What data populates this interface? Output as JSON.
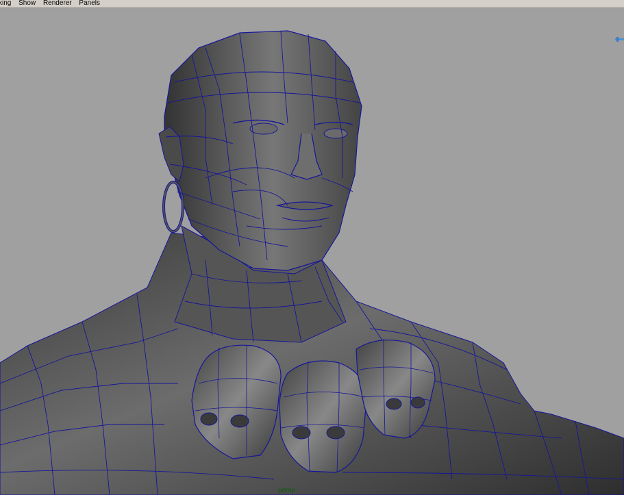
{
  "menubar": {
    "items": [
      {
        "label": "king"
      },
      {
        "label": "Show"
      },
      {
        "label": "Renderer"
      },
      {
        "label": "Panels"
      }
    ]
  },
  "viewport": {
    "camera_label": "persp",
    "colors": {
      "background": "#a0a0a0",
      "wire": "#16169a",
      "skin_light": "#7c7c7c",
      "skin_dark": "#2e2e2e",
      "camera_label": "#0c5c0c"
    },
    "icons": [
      "manipulator-icon"
    ]
  }
}
